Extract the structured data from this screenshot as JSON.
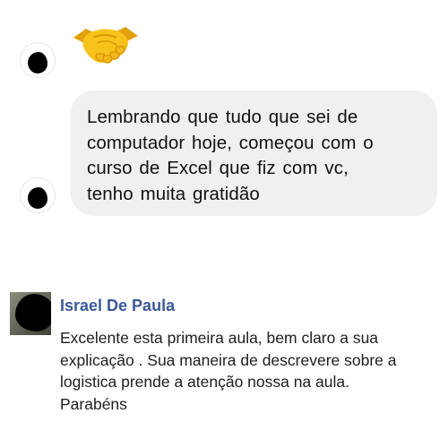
{
  "messages": [
    {
      "type": "emoji",
      "icon": "handshake-emoji",
      "color": "#f5b81c"
    },
    {
      "type": "text",
      "text": "Lembrando  que tudo  que sei  de\ncomputador  hoje, começou  com  o\ncurso  de Excel  que  fiz  com vc,\ntenho  muita  gratidão"
    }
  ],
  "comment": {
    "author": "Israel De Paula",
    "author_color": "#3b5998",
    "text": "Excelente esta primeira aula, bem claro a sua\nexplicação . Sua maneira de descrevere sobre a\nlogistica prende a atenção nossa na aula.\nParabéns"
  }
}
